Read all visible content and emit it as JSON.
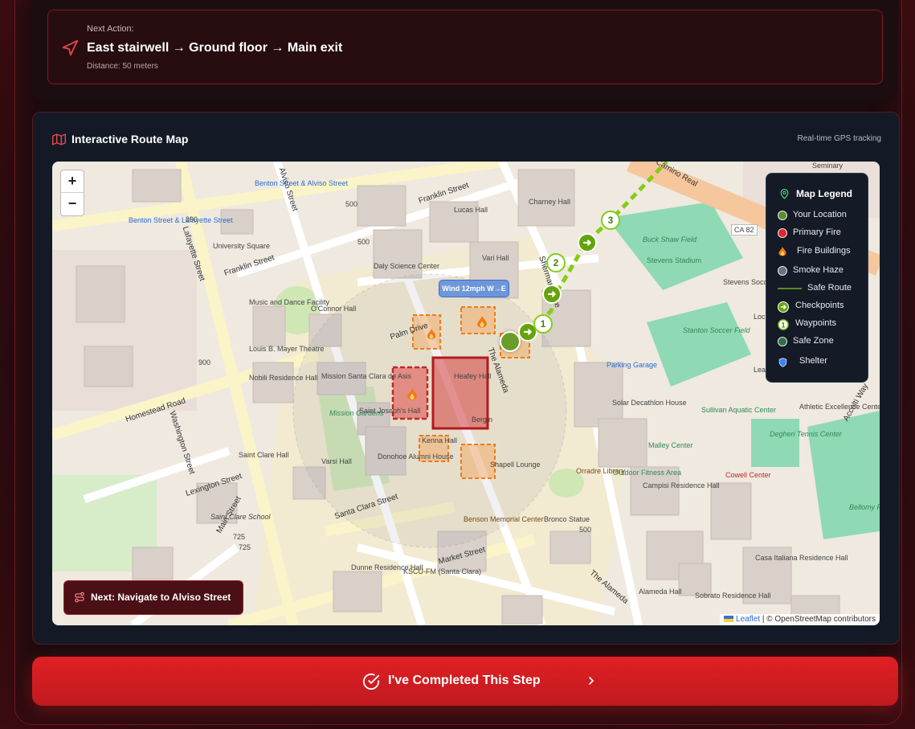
{
  "next_action": {
    "label": "Next Action:",
    "instruction": "East stairwell → Ground floor → Main exit",
    "distance": "Distance: 50 meters"
  },
  "map_card": {
    "title": "Interactive Route Map",
    "subtitle": "Real-time GPS tracking",
    "zoom_in": "+",
    "zoom_out": "−",
    "wind_label": "Wind 12mph W→E",
    "next_navigation": "Next: Navigate to Alviso Street",
    "attribution_link": "Leaflet",
    "attribution_text": "| © OpenStreetMap contributors",
    "waypoints": [
      "1",
      "2",
      "3"
    ]
  },
  "legend": {
    "title": "Map Legend",
    "items": [
      {
        "label": "Your Location",
        "color": "#5a8f2a",
        "icon": "location-dot"
      },
      {
        "label": "Primary Fire",
        "color": "#e0282e",
        "icon": "fire-dot"
      },
      {
        "label": "Fire Buildings",
        "color": "#f07a1a",
        "icon": "flame-icon"
      },
      {
        "label": "Smoke Haze",
        "color": "#6b7280",
        "icon": "smoke-dot"
      },
      {
        "label": "Safe Route",
        "color": "#84cc16",
        "icon": "route-line"
      },
      {
        "label": "Checkpoints",
        "color": "#65a30d",
        "icon": "arrow-circle"
      },
      {
        "label": "Waypoints",
        "color": "#84cc16",
        "icon": "number-circle"
      },
      {
        "label": "Safe Zone",
        "color": "#2f6f4a",
        "icon": "zone-dot"
      },
      {
        "label": "Shelter",
        "color": "#3b82f6",
        "icon": "shield-icon"
      }
    ]
  },
  "map_labels": {
    "franklin_st": "Franklin Street",
    "alviso_st": "Alviso Street",
    "lafayette_st": "Lafayette Street",
    "homestead_rd": "Homestead Road",
    "washington_st": "Washington Street",
    "lexington_st": "Lexington Street",
    "santa_clara_st": "Santa Clara Street",
    "market_st": "Market Street",
    "the_alameda": "The Alameda",
    "palm_drive": "Palm Drive",
    "sherman_drive": "Sherman Drive",
    "main_st": "Main Street",
    "university_sq": "University Square",
    "daly_science": "Daly Science Center",
    "lucas_hall": "Lucas Hall",
    "charney_hall": "Charney Hall",
    "vari_hall": "Vari Hall",
    "oconnor_hall": "O'Connor Hall",
    "mission": "Mission Santa Clara de Asis",
    "mission_gardens": "Mission Gardens",
    "heafey_hall": "Heafey Hall",
    "bergin": "Bergin",
    "kenna_hall": "Kenna Hall",
    "shapell_lounge": "Shapell Lounge",
    "donohoe": "Donohoe Alumni House",
    "varsi_hall": "Varsi Hall",
    "nobili": "Nobili Residence Hall",
    "mayer_theatre": "Louis B. Mayer Theatre",
    "music_dance": "Music and Dance Facility",
    "saint_josephs": "Saint Joseph's Hall",
    "saint_clare_hall": "Saint Clare Hall",
    "saint_clare_school": "Saint Clare School",
    "benson": "Benson Memorial Center",
    "orradre": "Orradre Library",
    "bronco": "Bronco Statue",
    "solar_decathlon": "Solar Decathlon House",
    "malley": "Malley Center",
    "stevens_stadium": "Stevens Stadium",
    "buck_shaw": "Buck Shaw Field",
    "stevens_soccer": "Stevens Soccer Training Center",
    "stanton": "Stanton Soccer Field",
    "sullivan": "Sullivan Aquatic Center",
    "degheri": "Degheri Tennis Center",
    "athletic": "Athletic Excellence Center",
    "bellomy": "Bellomy Field",
    "cowell": "Cowell Center",
    "campisi": "Campisi Residence Hall",
    "casa": "Casa Italiana Residence Hall",
    "sobrato": "Sobrato Residence Hall",
    "alameda_hall": "Alameda Hall",
    "dunne": "Dunne Residence Hall",
    "kscu": "KSCU-FM (Santa Clara)",
    "parking_garage": "Parking Garage",
    "outdoor_fitness": "Outdoor Fitness Area",
    "benton_alviso": "Benton Street & Alviso Street",
    "benton_lafayette": "Benton Street & Lafayette Street",
    "ca82": "CA 82",
    "seminary": "Seminary",
    "n890": "890",
    "n900": "900",
    "n500a": "500",
    "n500b": "500",
    "n500c": "500",
    "n725a": "725",
    "n725b": "725",
    "accolti": "Accolti Way",
    "real": "Camino Real",
    "leavey": "Lea Event Center",
    "loc": "Loc"
  },
  "complete_button": "I've Completed This Step"
}
